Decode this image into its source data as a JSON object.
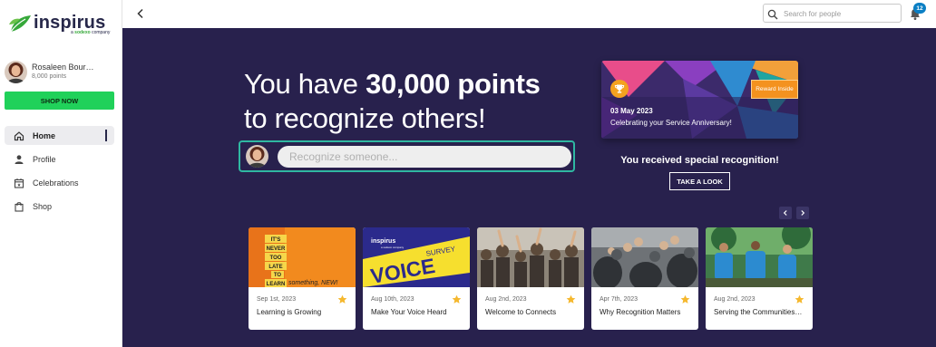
{
  "brand": {
    "name": "inspirus",
    "tag_prefix": "a ",
    "tag_brand": "sodexo",
    "tag_suffix": " company",
    "brand_color": "#27284a",
    "leaf_color": "#36a83a"
  },
  "user": {
    "name": "Rosaleen Bour…",
    "points": "8,000 points"
  },
  "shop_now": "SHOP NOW",
  "nav": [
    {
      "label": "Home",
      "icon": "home-icon",
      "active": true
    },
    {
      "label": "Profile",
      "icon": "person-icon",
      "active": false
    },
    {
      "label": "Celebrations",
      "icon": "calendar-icon",
      "active": false
    },
    {
      "label": "Shop",
      "icon": "shopping-bag-icon",
      "active": false
    }
  ],
  "topbar": {
    "search_placeholder": "Search for people",
    "notification_count": "12"
  },
  "hero": {
    "line1_prefix": "You have ",
    "points": "30,000 points",
    "line2": "to recognize others!",
    "recognize_placeholder": "Recognize someone..."
  },
  "award": {
    "badge": "Reward Inside",
    "date": "03 May 2023",
    "text": "Celebrating your Service Anniversary!",
    "received": "You received special recognition!",
    "take_look": "TAKE A LOOK"
  },
  "cards": [
    {
      "date": "Sep 1st, 2023",
      "title": "Learning is Growing",
      "image": "sign-its-never-too-late-to-learn",
      "img_words": [
        "IT'S",
        "NEVER",
        "TOO",
        "LATE",
        "TO",
        "LEARN"
      ],
      "img_tail": "something, NEW!"
    },
    {
      "date": "Aug 10th, 2023",
      "title": "Make Your Voice Heard",
      "image": "voice-survey-banner",
      "img_brand": "inspirus",
      "img_brand_sub": "a sodexo company",
      "img_main": "VOICE",
      "img_sub": "SURVEY",
      "img_foot": "powered by The Happiness Index"
    },
    {
      "date": "Aug 2nd, 2023",
      "title": "Welcome to Connects",
      "image": "crowd-celebrating-photo"
    },
    {
      "date": "Apr 7th, 2023",
      "title": "Why Recognition Matters",
      "image": "group-clapping-photo"
    },
    {
      "date": "Aug 2nd, 2023",
      "title": "Serving the Communities…",
      "image": "volunteers-outdoors-photo"
    }
  ],
  "colors": {
    "main_bg": "#28214d",
    "shop_green": "#20d15a",
    "accent_teal": "#2fb8a2",
    "star": "#f5b82e",
    "badge_blue": "#0b7fc4",
    "reward_orange": "#f4921f"
  }
}
